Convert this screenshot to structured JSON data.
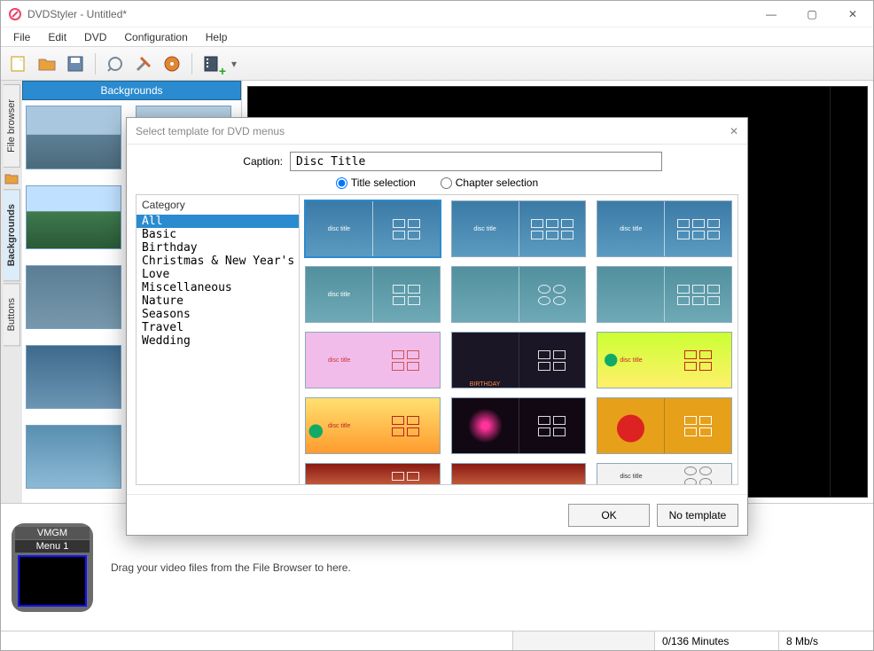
{
  "window": {
    "title": "DVDStyler - Untitled*",
    "min": "—",
    "max": "▢",
    "close": "✕"
  },
  "menu": {
    "file": "File",
    "edit": "Edit",
    "dvd": "DVD",
    "config": "Configuration",
    "help": "Help"
  },
  "tabs": {
    "file_browser": "File browser",
    "backgrounds": "Backgrounds",
    "buttons": "Buttons"
  },
  "side_header": "Backgrounds",
  "timeline": {
    "label1": "VMGM",
    "label2": "Menu 1",
    "hint": "Drag your video files from the File Browser to here."
  },
  "status": {
    "dur": "0/136 Minutes",
    "rate": "8 Mb/s"
  },
  "dialog": {
    "title": "Select template for DVD menus",
    "caption_label": "Caption:",
    "caption_value": "Disc Title",
    "radio_title": "Title selection",
    "radio_chapter": "Chapter selection",
    "category_label": "Category",
    "categories": [
      "All",
      "Basic",
      "Birthday",
      "Christmas & New Year's Eve",
      "Love",
      "Miscellaneous",
      "Nature",
      "Seasons",
      "Travel",
      "Wedding"
    ],
    "selected_category_index": 0,
    "ok": "OK",
    "no_template": "No template"
  }
}
